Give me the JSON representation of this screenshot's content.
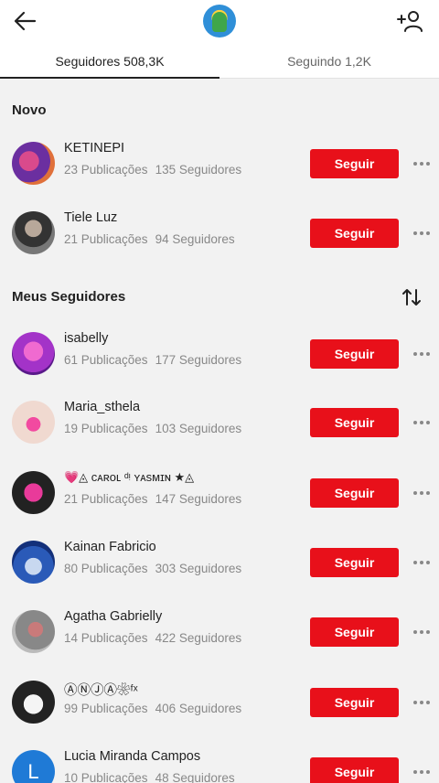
{
  "tabs": [
    {
      "label": "Seguidores 508,3K"
    },
    {
      "label": "Seguindo 1,2K"
    }
  ],
  "icons": {
    "back": "arrow-left-icon",
    "add_user": "add-user-icon",
    "sort": "sort-arrows-icon",
    "more": "more-dots-icon"
  },
  "colors": {
    "accent": "#e8101a"
  },
  "sections": {
    "new_title": "Novo",
    "followers_title": "Meus Seguidores"
  },
  "new_users": [
    {
      "name": "KETINEPI",
      "posts": "23 Publicações",
      "followers": "135 Seguidores",
      "button": "Seguir"
    },
    {
      "name": "Tiele Luz",
      "posts": "21 Publicações",
      "followers": "94 Seguidores",
      "button": "Seguir"
    }
  ],
  "followers": [
    {
      "name": "isabelly",
      "posts": "61 Publicações",
      "followers": "177 Seguidores",
      "button": "Seguir"
    },
    {
      "name": "Maria_sthela",
      "posts": "19 Publicações",
      "followers": "103 Seguidores",
      "button": "Seguir"
    },
    {
      "name": "💗◬ ᴄᴀʀᴏʟ ᵈᵎ ʏᴀsᴍɪɴ ★◬",
      "posts": "21 Publicações",
      "followers": "147 Seguidores",
      "button": "Seguir"
    },
    {
      "name": "Kainan Fabricio",
      "posts": "80 Publicações",
      "followers": "303 Seguidores",
      "button": "Seguir"
    },
    {
      "name": "Agatha Gabrielly",
      "posts": "14 Publicações",
      "followers": "422 Seguidores",
      "button": "Seguir"
    },
    {
      "name": "ⒶⓃⒿⒶ❀ᶠˣ",
      "posts": "99 Publicações",
      "followers": "406 Seguidores",
      "button": "Seguir"
    },
    {
      "name": "Lucia Miranda Campos",
      "posts": "10 Publicações",
      "followers": "48 Seguidores",
      "button": "Seguir",
      "avatar_letter": "L"
    }
  ]
}
